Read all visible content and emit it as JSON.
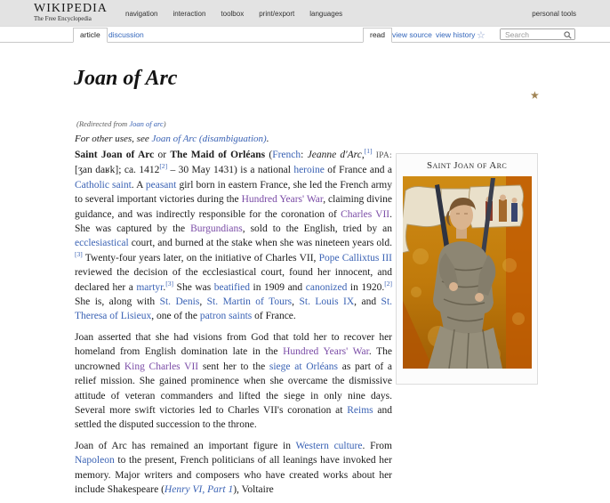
{
  "header": {
    "logo_title": "WIKIPEDIA",
    "logo_tagline": "The Free Encyclopedia",
    "menus": [
      "navigation",
      "interaction",
      "toolbox",
      "print/export",
      "languages"
    ],
    "personal_tools": "personal tools"
  },
  "tabs": {
    "article": "article",
    "discussion": "discussion",
    "read": "read",
    "view_source": "view source",
    "view_history": "view history",
    "search_placeholder": "Search"
  },
  "icons": {
    "watch_star": "☆",
    "featured_star": "★",
    "search_icon": "magnifier"
  },
  "colors": {
    "topbar_gray": "#e3e3e3",
    "link_blue": "#3a62b4",
    "visited_purple": "#7a4ba6",
    "chrome_link_blue": "#3366bb",
    "featured_star_bronze": "#a08353",
    "watch_star_blue": "#8aa0cc"
  },
  "article": {
    "title": "Joan of Arc",
    "redirect": [
      {
        "x": "(Redirected from "
      },
      {
        "t": "a",
        "x": "Joan of arc"
      },
      {
        "x": ")"
      }
    ],
    "hatnote": [
      {
        "x": "For other uses, see "
      },
      {
        "t": "a",
        "x": "Joan of Arc (disambiguation)"
      },
      {
        "x": "."
      }
    ],
    "paragraphs": [
      [
        {
          "t": "b",
          "x": "Saint Joan of Arc"
        },
        {
          "x": " or "
        },
        {
          "t": "b",
          "x": "The Maid of Orléans"
        },
        {
          "x": " ("
        },
        {
          "t": "a",
          "x": "French"
        },
        {
          "x": ": "
        },
        {
          "t": "i",
          "x": "Jeanne d'Arc"
        },
        {
          "x": ","
        },
        {
          "t": "sup",
          "x": "[1]"
        },
        {
          "x": " "
        },
        {
          "t": "ipa",
          "x": "IPA:"
        },
        {
          "x": " [ʒan daʁk]; ca. 1412"
        },
        {
          "t": "sup",
          "x": "[2]"
        },
        {
          "x": " – 30 May 1431) is a national "
        },
        {
          "t": "a",
          "x": "heroine"
        },
        {
          "x": " of France and a "
        },
        {
          "t": "a",
          "x": "Catholic saint"
        },
        {
          "x": ". A "
        },
        {
          "t": "a",
          "x": "peasant"
        },
        {
          "x": " girl born in eastern France, she led the French army to several important victories during the "
        },
        {
          "t": "v",
          "x": "Hundred Years' War"
        },
        {
          "x": ", claiming divine guidance, and was indirectly responsible for the coronation of "
        },
        {
          "t": "v",
          "x": "Charles VII"
        },
        {
          "x": ". She was captured by the "
        },
        {
          "t": "v",
          "x": "Burgundians"
        },
        {
          "x": ", sold to the English, tried by an "
        },
        {
          "t": "a",
          "x": "ecclesiastical"
        },
        {
          "x": " court, and burned at the stake when she was nineteen years old."
        },
        {
          "t": "sup",
          "x": "[3]"
        },
        {
          "x": " Twenty-four years later, on the initiative of Charles VII, "
        },
        {
          "t": "a",
          "x": "Pope Callixtus III"
        },
        {
          "x": " reviewed the decision of the ecclesiastical court, found her innocent, and declared her a "
        },
        {
          "t": "a",
          "x": "martyr"
        },
        {
          "x": "."
        },
        {
          "t": "sup",
          "x": "[3]"
        },
        {
          "x": " She was "
        },
        {
          "t": "a",
          "x": "beatified"
        },
        {
          "x": " in 1909 and "
        },
        {
          "t": "a",
          "x": "canonized"
        },
        {
          "x": " in 1920."
        },
        {
          "t": "sup",
          "x": "[2]"
        },
        {
          "x": " She is, along with "
        },
        {
          "t": "a",
          "x": "St. Denis"
        },
        {
          "x": ", "
        },
        {
          "t": "a",
          "x": "St. Martin of Tours"
        },
        {
          "x": ", "
        },
        {
          "t": "a",
          "x": "St. Louis IX"
        },
        {
          "x": ", and "
        },
        {
          "t": "a",
          "x": "St. Theresa of Lisieux"
        },
        {
          "x": ", one of the "
        },
        {
          "t": "a",
          "x": "patron saints"
        },
        {
          "x": " of France."
        }
      ],
      [
        {
          "x": "Joan asserted that she had visions from God that told her to recover her homeland from English domination late in the "
        },
        {
          "t": "v",
          "x": "Hundred Years' War"
        },
        {
          "x": ". The uncrowned "
        },
        {
          "t": "v",
          "x": "King Charles VII"
        },
        {
          "x": " sent her to the "
        },
        {
          "t": "a",
          "x": "siege at Orléans"
        },
        {
          "x": " as part of a relief mission. She gained prominence when she overcame the dismissive attitude of veteran commanders and lifted the siege in only nine days. Several more swift victories led to Charles VII's coronation at "
        },
        {
          "t": "a",
          "x": "Reims"
        },
        {
          "x": " and settled the disputed succession to the throne."
        }
      ],
      [
        {
          "x": "Joan of Arc has remained an important figure in "
        },
        {
          "t": "a",
          "x": "Western culture"
        },
        {
          "x": ". From "
        },
        {
          "t": "a",
          "x": "Napoleon"
        },
        {
          "x": " to the present, French politicians of all leanings have invoked her memory. Major writers and composers who have created works about her include Shakespeare ("
        },
        {
          "t": "ia",
          "x": "Henry VI, Part 1"
        },
        {
          "x": "), Voltaire"
        }
      ]
    ]
  },
  "infobox": {
    "title": "Saint Joan of Arc",
    "image_alt": "Medieval miniature painting of Joan of Arc in armor holding a sword and banner"
  }
}
